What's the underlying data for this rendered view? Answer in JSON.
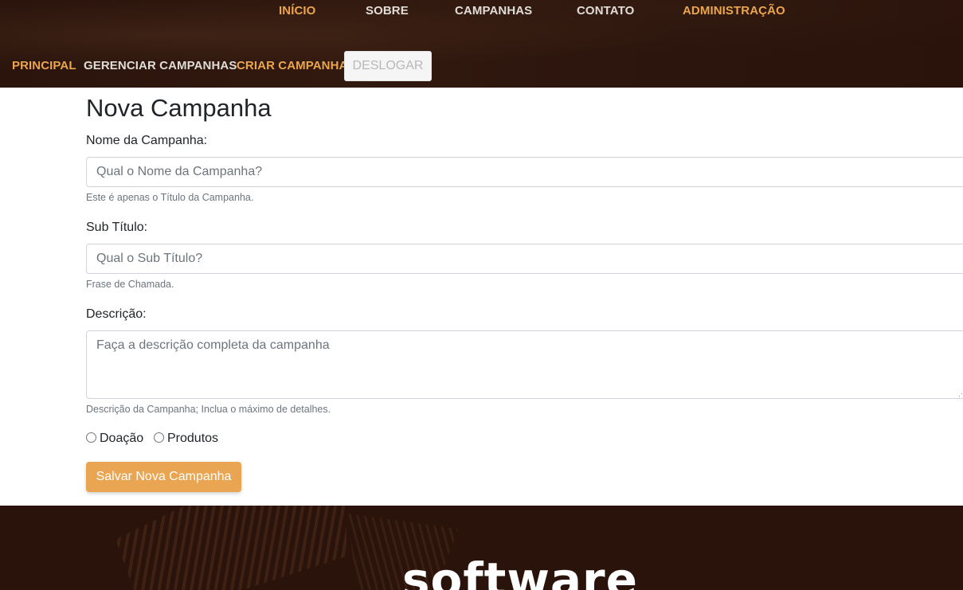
{
  "main_nav": {
    "items": [
      {
        "label": "INÍCIO",
        "color": "#eba54d"
      },
      {
        "label": "SOBRE",
        "color": "#e0dcd6"
      },
      {
        "label": "CAMPANHAS",
        "color": "#e0dcd6"
      },
      {
        "label": "CONTATO",
        "color": "#e0dcd6"
      },
      {
        "label": "ADMINISTRAÇÃO",
        "color": "#eba54d"
      }
    ]
  },
  "sub_nav": {
    "items": [
      {
        "label": "PRINCIPAL"
      },
      {
        "label": "GERENCIAR CAMPANHAS"
      },
      {
        "label": "CRIAR CAMPANHA"
      }
    ],
    "logout_label": "DESLOGAR"
  },
  "form": {
    "title": "Nova Campanha",
    "name": {
      "label": "Nome da Campanha:",
      "placeholder": "Qual o Nome da Campanha?",
      "help": "Este é apenas o Título da Campanha."
    },
    "subtitle": {
      "label": "Sub Título:",
      "placeholder": "Qual o Sub Título?",
      "help": "Frase de Chamada."
    },
    "description": {
      "label": "Descrição:",
      "placeholder": "Faça a descrição completa da campanha",
      "help": "Descrição da Campanha; Inclua o máximo de detalhes."
    },
    "type_options": [
      "Doação",
      "Produtos"
    ],
    "submit_label": "Salvar Nova Campanha"
  },
  "footer": {
    "brand_text": "software"
  },
  "colors": {
    "accent": "#e9a551",
    "header_bg": "#2a130b"
  }
}
